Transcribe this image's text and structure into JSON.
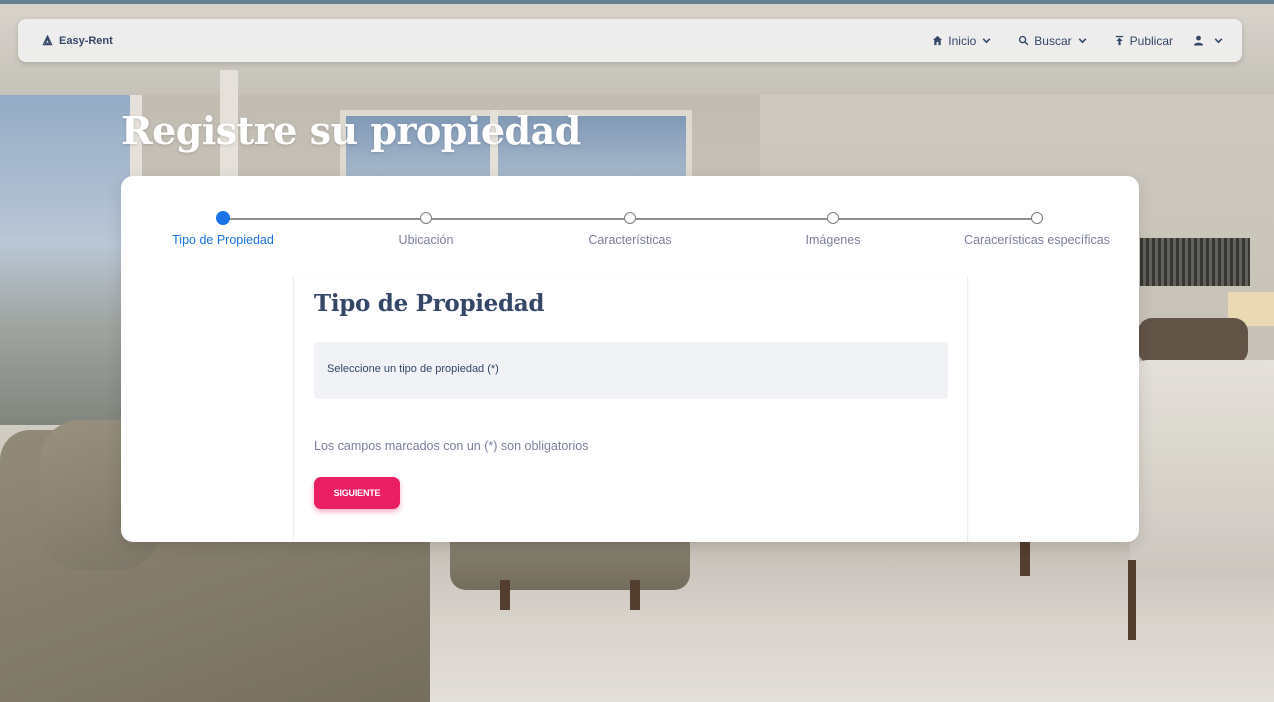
{
  "navbar": {
    "brand": "Easy-Rent",
    "items": [
      {
        "label": "Inicio",
        "icon": "home-icon",
        "has_dropdown": true
      },
      {
        "label": "Buscar",
        "icon": "search-icon",
        "has_dropdown": true
      },
      {
        "label": "Publicar",
        "icon": "upload-icon",
        "has_dropdown": false
      },
      {
        "label": "",
        "icon": "user-icon",
        "has_dropdown": true
      }
    ]
  },
  "page": {
    "title": "Registre su propiedad"
  },
  "stepper": {
    "active_index": 0,
    "steps": [
      {
        "label": "Tipo de Propiedad"
      },
      {
        "label": "Ubicación"
      },
      {
        "label": "Características"
      },
      {
        "label": "Imágenes"
      },
      {
        "label": "Caracerísticas específicas"
      }
    ]
  },
  "form": {
    "title": "Tipo de Propiedad",
    "select_placeholder": "Seleccione un tipo de propiedad (*)",
    "required_note": "Los campos marcados con un (*) son obligatorios",
    "next_button": "SIGUIENTE"
  },
  "colors": {
    "accent": "#1a73e8",
    "primary_button": "#e91e63",
    "text_dark": "#344767",
    "text_muted": "#7b809a"
  }
}
